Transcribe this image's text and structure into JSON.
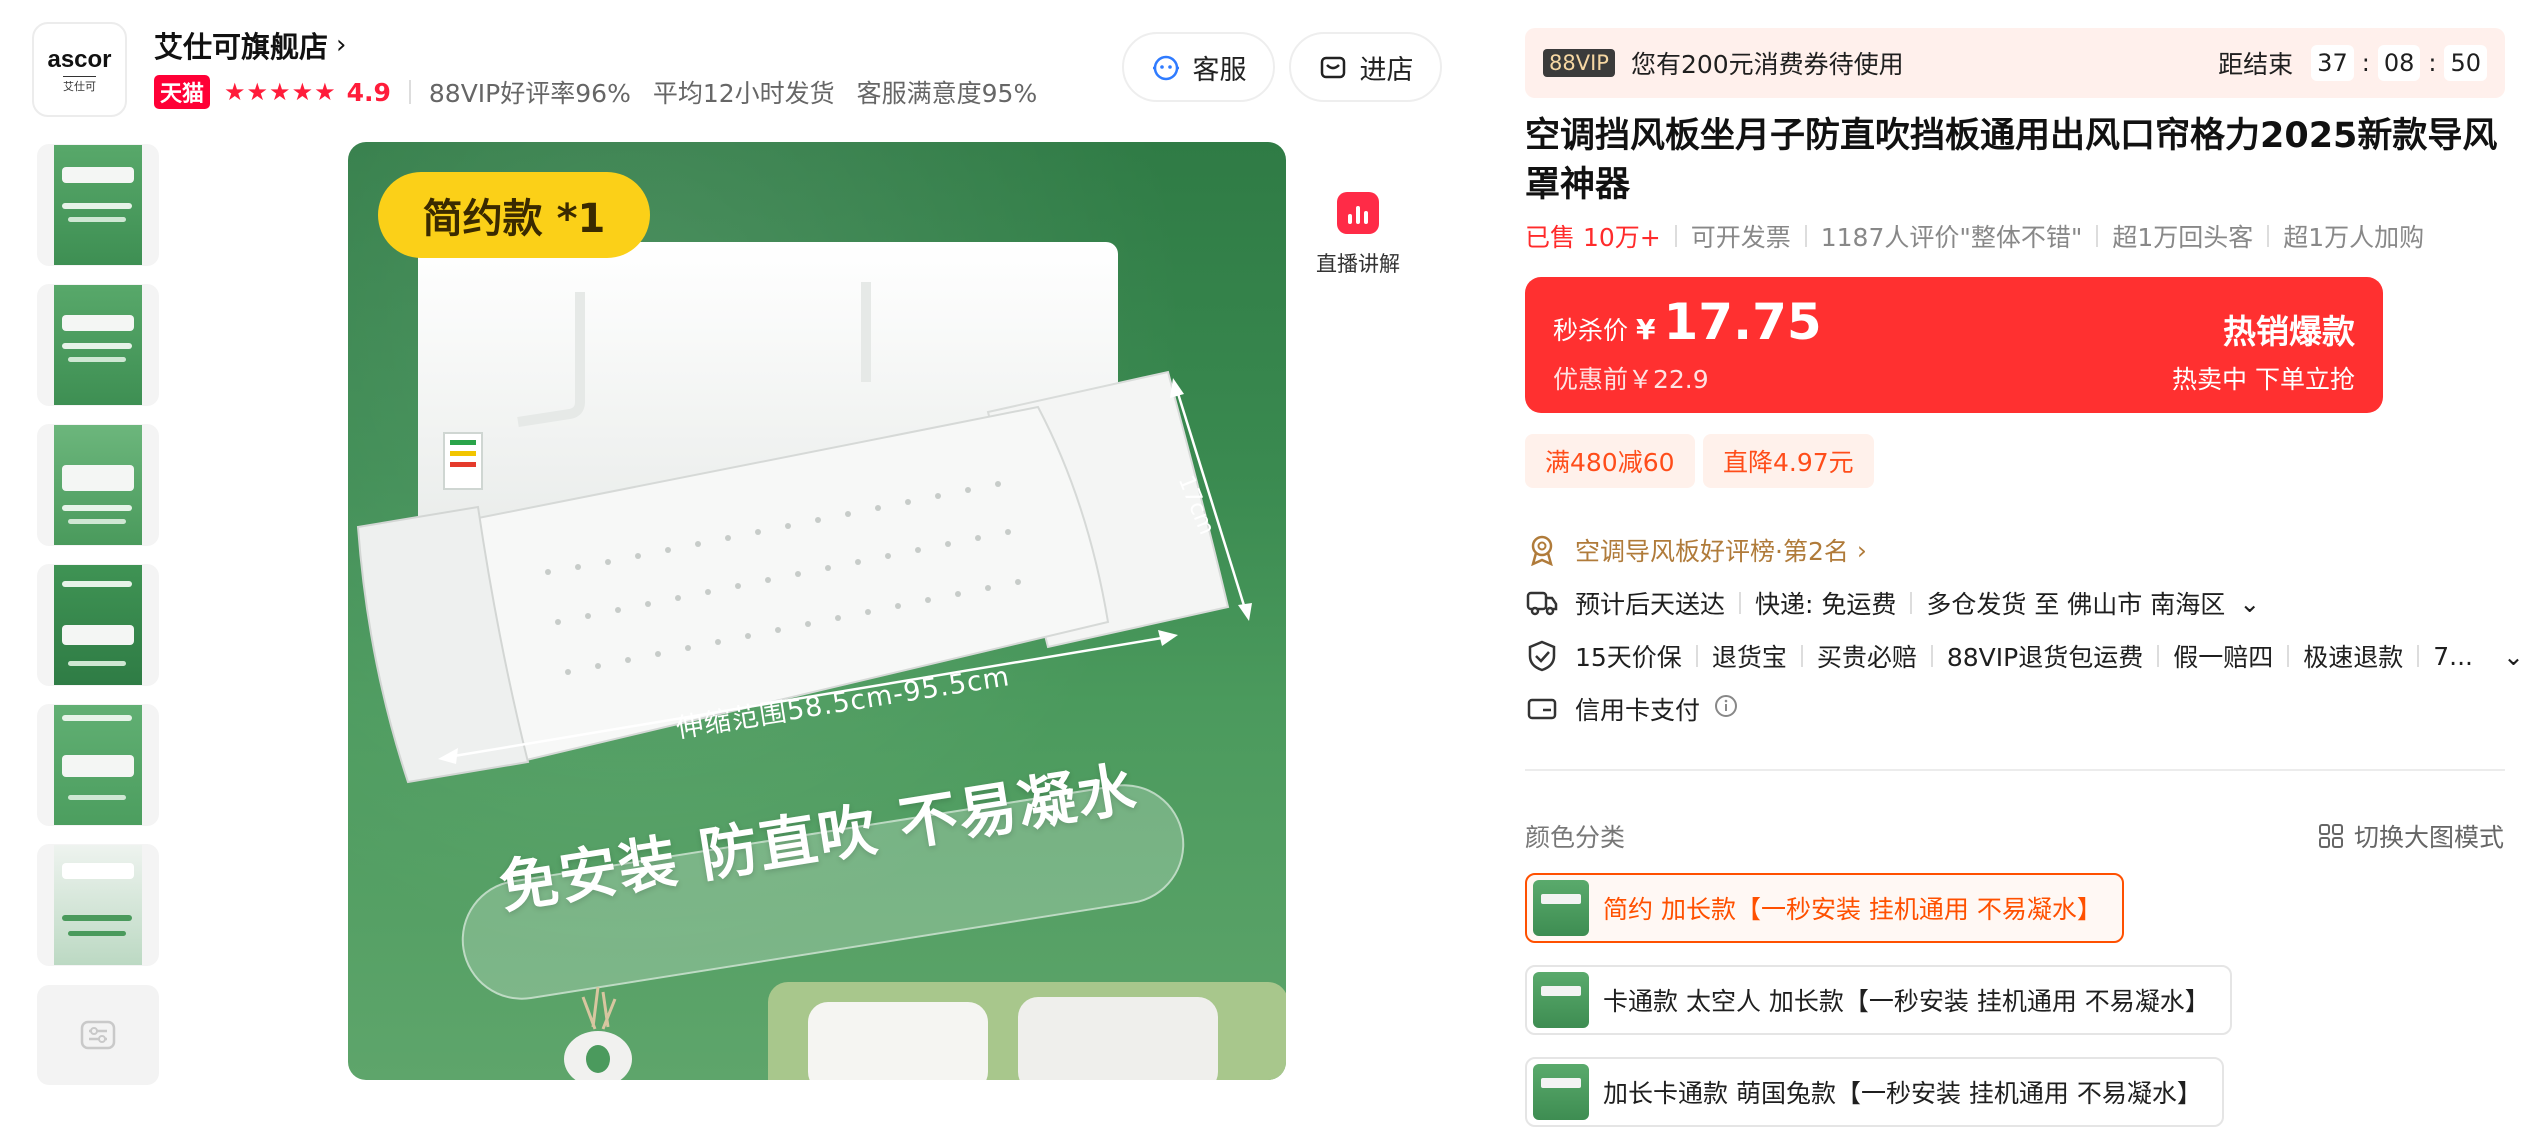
{
  "shop": {
    "logo_text": "ascor",
    "logo_sub": "艾仕可",
    "name": "艾仕可旗舰店",
    "chevron": "›",
    "tmall_badge": "天猫",
    "stars": "★★★★★",
    "rating": "4.9",
    "meta": [
      "88VIP好评率96%",
      "平均12小时发货",
      "客服满意度95%"
    ],
    "service_button": "客服",
    "enter_store_button": "进店"
  },
  "gallery": {
    "thumbnail_count": 6,
    "live_label": "直播讲解",
    "main_image": {
      "badge": "简约款 *1",
      "range_text": "伸缩范围58.5cm-95.5cm",
      "height_text": "17cm",
      "slogan": "免安装  防直吹  不易凝水"
    }
  },
  "promo": {
    "vip_tag": "88VIP",
    "vip_text": "您有200元消费券待使用",
    "countdown_label": "距结束",
    "hours": "37",
    "minutes": "08",
    "seconds": "50",
    "colon": ":"
  },
  "product": {
    "title": "空调挡风板坐月子防直吹挡板通用出风口帘格力2025新款导风罩神器",
    "sold": "已售 10万+",
    "tags": [
      "可开发票",
      "1187人评价\"整体不错\"",
      "超1万回头客",
      "超1万人加购"
    ]
  },
  "price": {
    "label": "秒杀价",
    "currency": "¥",
    "value": "17.75",
    "original": "优惠前￥22.9",
    "hot_title": "热销爆款",
    "hot_sub": "热卖中  下单立抢"
  },
  "coupons": [
    "满480减60",
    "直降4.97元"
  ],
  "info": {
    "rank": "空调导风板好评榜·第2名",
    "rank_chevron": "›",
    "delivery": "预计后天送达",
    "shipping": "快递: 免运费",
    "warehouse": "多仓发货 至 佛山市 南海区",
    "guarantees": [
      "15天价保",
      "退货宝",
      "买贵必赔",
      "88VIP退货包运费",
      "假一赔四",
      "极速退款",
      "7..."
    ],
    "payment": "信用卡支付",
    "dropdown_glyph": "⌄"
  },
  "sku": {
    "label": "颜色分类",
    "switch_view": "切换大图模式",
    "options": [
      "简约 加长款【一秒安装 挂机通用 不易凝水】",
      "卡通款 太空人 加长款【一秒安装 挂机通用 不易凝水】",
      "加长卡通款 萌国兔款【一秒安装 挂机通用 不易凝水】"
    ]
  },
  "colors": {
    "accent": "#ff5000",
    "price_bg": "#ff3030",
    "tmall_red": "#ff0036",
    "badge_yellow": "#fbd018"
  }
}
